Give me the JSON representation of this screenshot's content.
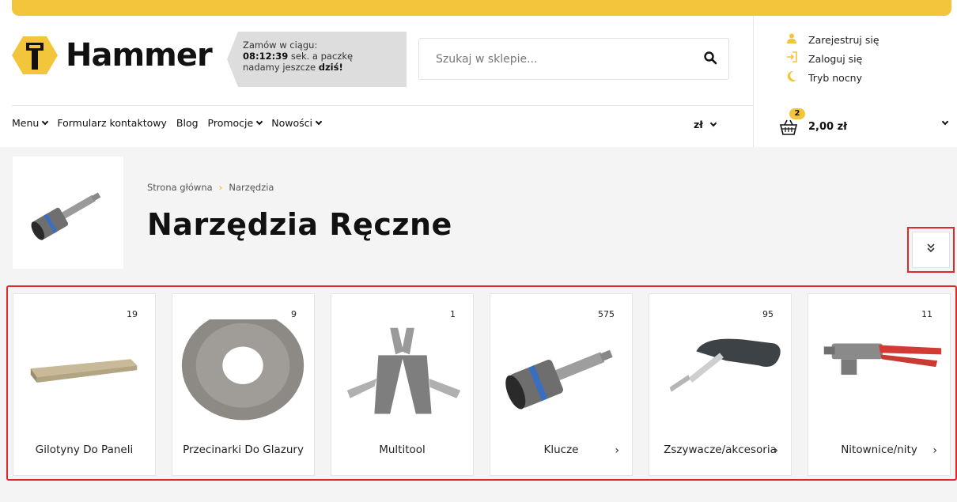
{
  "brand": {
    "name": "Hammer",
    "accent": "#f2c53a",
    "highlight": "#e0282b"
  },
  "promo": {
    "line1": "Zamów w ciągu:",
    "timer": "08:12:39",
    "line2_after_timer": " sek.  a paczkę",
    "line3_prefix": "nadamy jeszcze ",
    "line3_bold": "dziś!"
  },
  "search": {
    "placeholder": "Szukaj w sklepie..."
  },
  "account": [
    {
      "icon": "user-icon",
      "label": "Zarejestruj się"
    },
    {
      "icon": "login-icon",
      "label": "Zaloguj się"
    },
    {
      "icon": "moon-icon",
      "label": "Tryb nocny"
    }
  ],
  "nav": [
    {
      "label": "Menu",
      "dropdown": true
    },
    {
      "label": "Formularz kontaktowy",
      "dropdown": false
    },
    {
      "label": "Blog",
      "dropdown": false
    },
    {
      "label": "Promocje",
      "dropdown": true
    },
    {
      "label": "Nowości",
      "dropdown": true
    }
  ],
  "currency": "zł",
  "cart": {
    "count": "2",
    "total": "2,00 zł"
  },
  "breadcrumb": {
    "home": "Strona główna",
    "current": "Narzędzia"
  },
  "page_title": "Narzędzia Ręczne",
  "categories": [
    {
      "name": "Gilotyny Do Paneli",
      "count": "19",
      "has_arrow": false
    },
    {
      "name": "Przecinarki Do Glazury",
      "count": "9",
      "has_arrow": false
    },
    {
      "name": "Multitool",
      "count": "1",
      "has_arrow": false
    },
    {
      "name": "Klucze",
      "count": "575",
      "has_arrow": true
    },
    {
      "name": "Zszywacze/akcesoria",
      "count": "95",
      "has_arrow": true
    },
    {
      "name": "Nitownice/nity",
      "count": "11",
      "has_arrow": true
    }
  ]
}
